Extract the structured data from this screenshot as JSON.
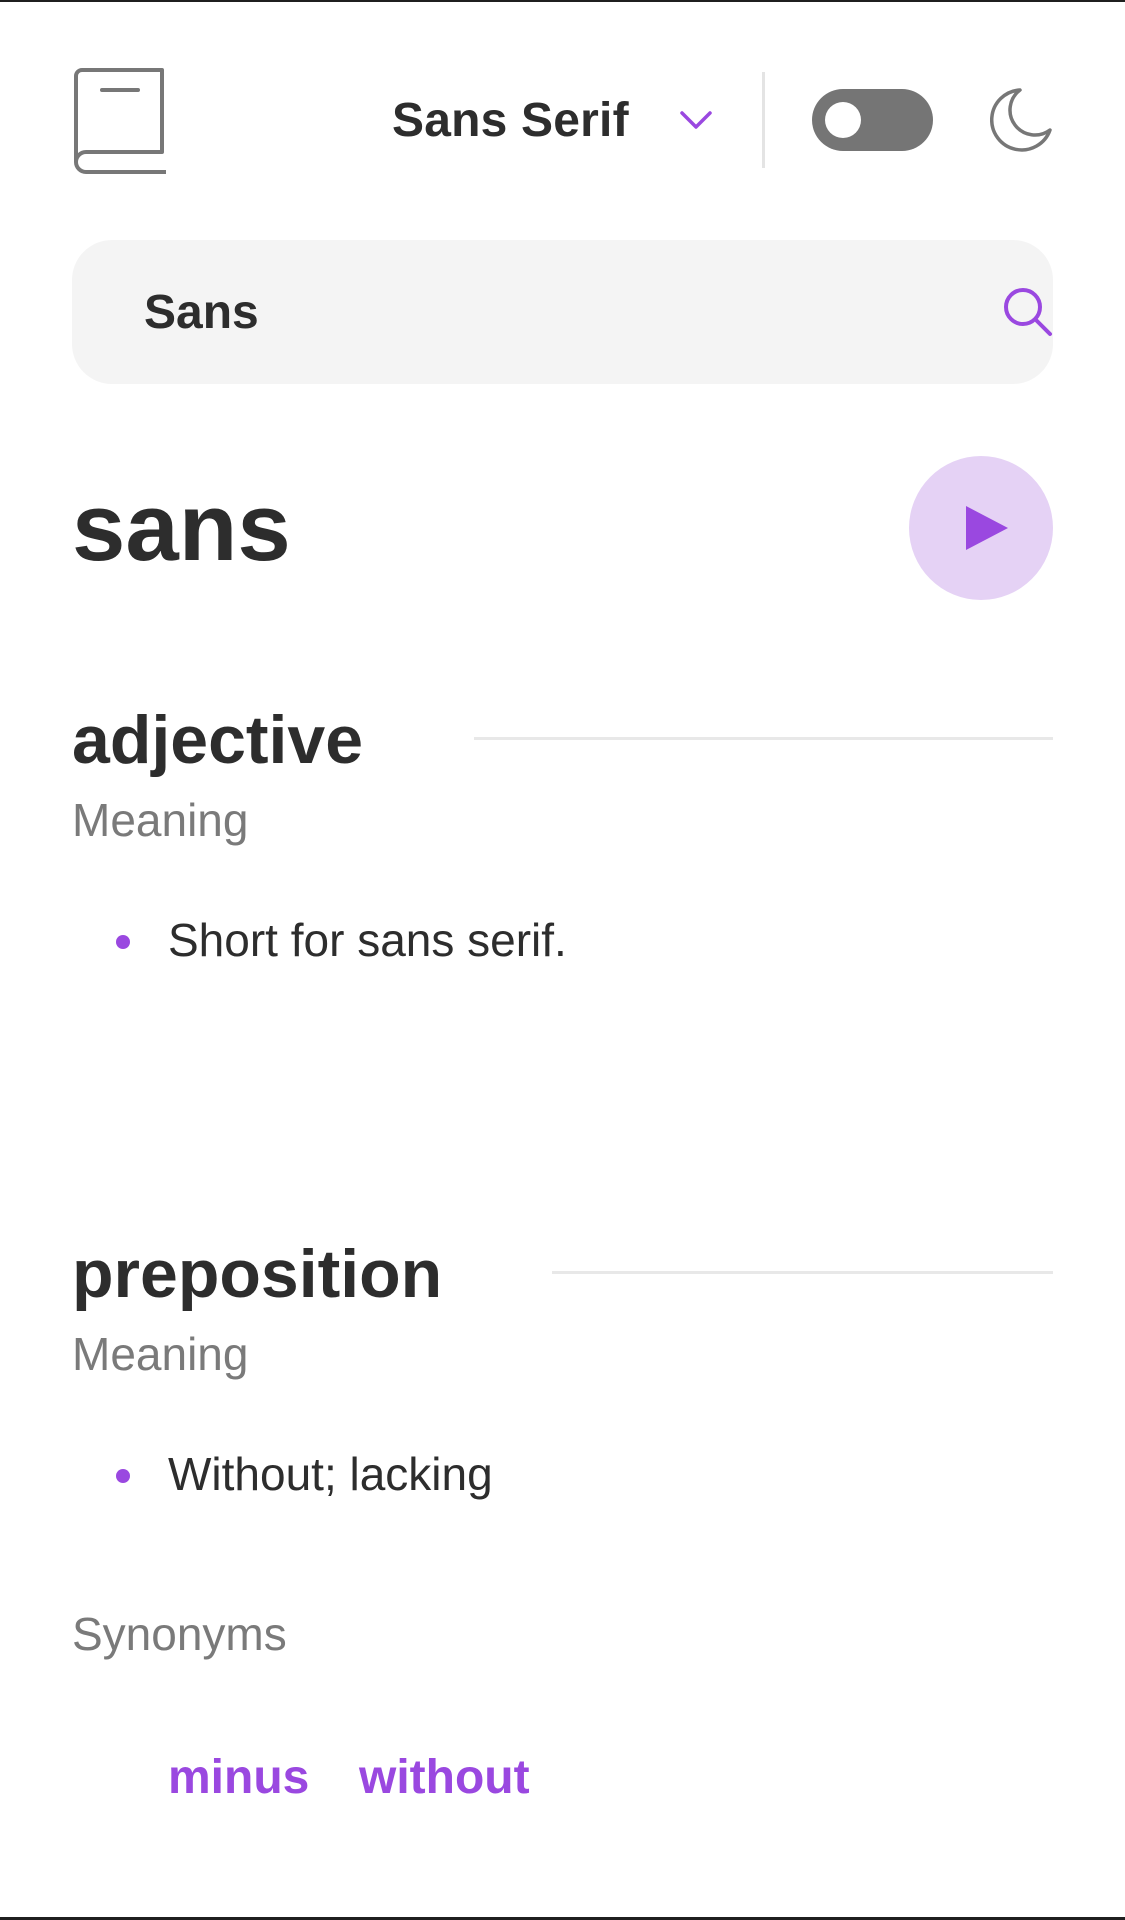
{
  "header": {
    "logo_icon": "book-icon",
    "font_selector": {
      "label": "Sans Serif",
      "icon": "chevron-down-icon"
    },
    "theme_toggle": {
      "state": "off"
    },
    "theme_icon": "moon-icon"
  },
  "search": {
    "value": "Sans",
    "icon": "search-icon"
  },
  "entry": {
    "word": "sans",
    "play_icon": "play-icon",
    "sections": [
      {
        "part_of_speech": "adjective",
        "meaning_label": "Meaning",
        "definitions": [
          "Short for sans serif."
        ]
      },
      {
        "part_of_speech": "preposition",
        "meaning_label": "Meaning",
        "definitions": [
          "Without; lacking"
        ],
        "synonyms_label": "Synonyms",
        "synonyms": [
          "minus",
          "without"
        ]
      }
    ]
  },
  "colors": {
    "accent": "#9a48e0",
    "accent_light": "#e5d2f5",
    "text": "#2d2d2d",
    "muted": "#7a7a7a",
    "surface": "#f4f4f4"
  }
}
